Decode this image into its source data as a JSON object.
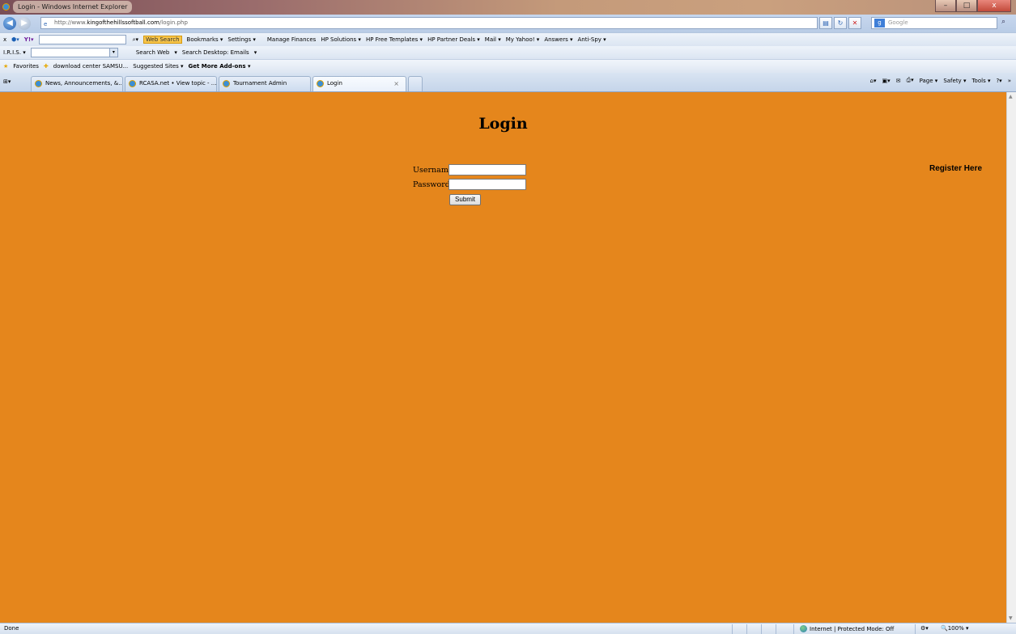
{
  "window": {
    "title": "Login - Windows Internet Explorer",
    "minimize": "–",
    "maximize": "□",
    "close": "x"
  },
  "address": {
    "url_prefix": "http://www.",
    "url_domain": "kingofthehillssoftball.com",
    "url_path": "/login.php",
    "search_placeholder": "Google",
    "search_logo": "g"
  },
  "yahoo_toolbar": {
    "close": "x",
    "web_search": "Web Search",
    "bookmarks": "Bookmarks ▾",
    "settings": "Settings ▾",
    "manage_finances": "Manage Finances",
    "hp_solutions": "HP Solutions ▾",
    "hp_free_templates": "HP Free Templates ▾",
    "hp_partner_deals": "HP Partner Deals ▾",
    "mail": "Mail ▾",
    "my_yahoo": "My Yahoo! ▾",
    "answers": "Answers ▾",
    "anti_spy": "Anti-Spy ▾"
  },
  "iris_toolbar": {
    "iris": "I.R.I.S. ▾",
    "search_web": "Search Web",
    "search_desktop": "Search Desktop: Emails"
  },
  "favorites_bar": {
    "favorites": "Favorites",
    "download_center": "download center SAMSU...",
    "suggested_sites": "Suggested Sites ▾",
    "get_more_addons": "Get More Add-ons ▾"
  },
  "tabs": [
    {
      "label": "News, Announcements, &..."
    },
    {
      "label": "RCASA.net • View topic - ..."
    },
    {
      "label": "Tournament Admin"
    },
    {
      "label": "Login"
    }
  ],
  "command_bar": {
    "page": "Page",
    "safety": "Safety",
    "tools": "Tools"
  },
  "page": {
    "heading": "Login",
    "register_link": "Register Here",
    "username_label": "Username:",
    "password_label": "Password:",
    "username_value": "",
    "password_value": "",
    "submit_label": "Submit",
    "background_color": "#e5861c"
  },
  "status": {
    "text": "Done",
    "zone": "Internet | Protected Mode: Off",
    "zoom": "100%"
  }
}
